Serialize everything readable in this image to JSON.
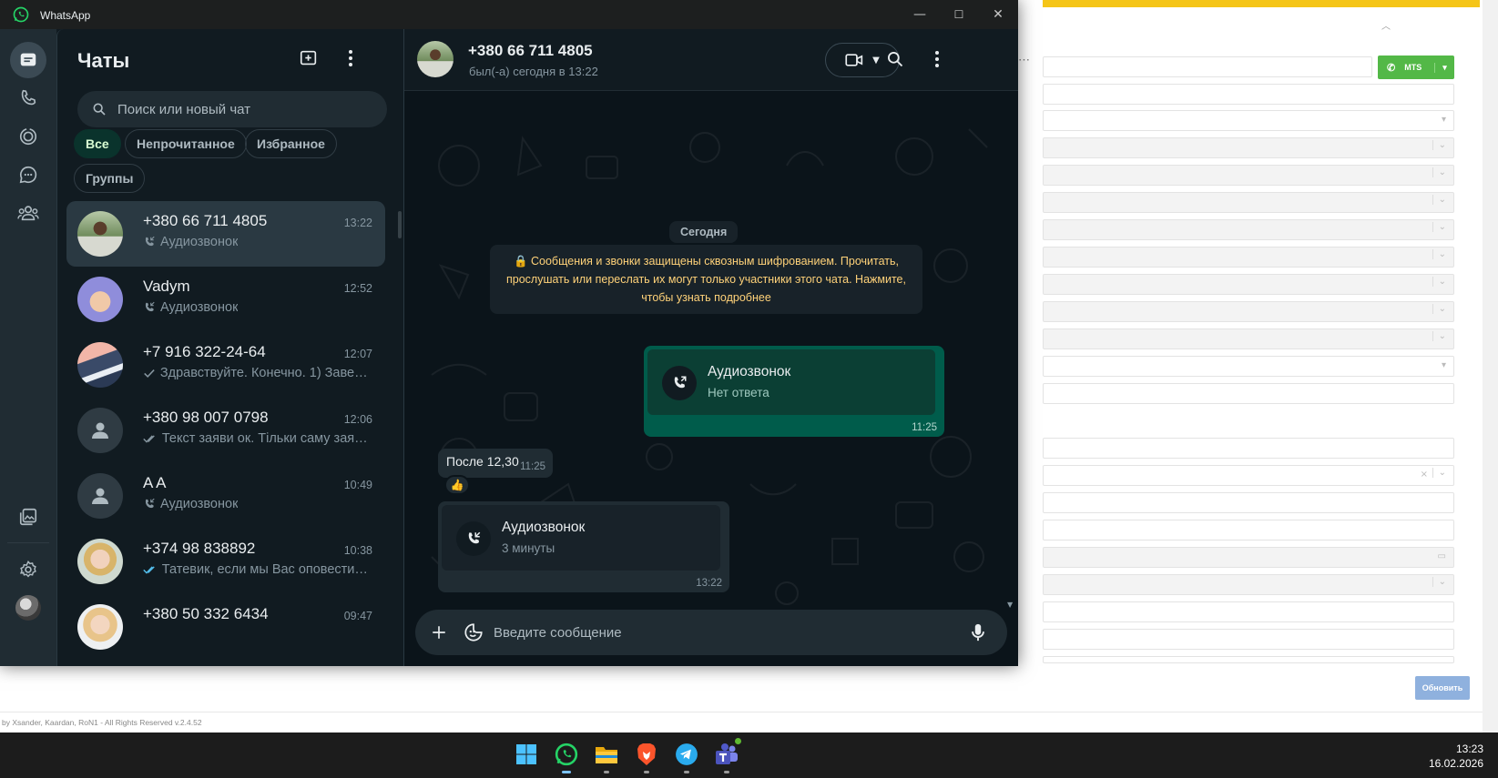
{
  "window": {
    "title": "WhatsApp"
  },
  "sidebar": {
    "title": "Чаты",
    "search_placeholder": "Поиск или новый чат",
    "filters": [
      "Все",
      "Непрочитанное",
      "Избранное",
      "Группы"
    ],
    "chats": [
      {
        "name": "+380 66 711 4805",
        "time": "13:22",
        "preview": "Аудиозвонок",
        "preview_icon": "call-icon",
        "selected": true
      },
      {
        "name": "Vadym",
        "time": "12:52",
        "preview": "Аудиозвонок",
        "preview_icon": "call-icon"
      },
      {
        "name": "+7 916 322-24-64",
        "time": "12:07",
        "preview": "Здравствуйте. Конечно. 1) Завер...",
        "preview_icon": "single-check-icon"
      },
      {
        "name": "+380 98 007 0798",
        "time": "12:06",
        "preview": "Текст заяви ок. Тільки саму заяв...",
        "preview_icon": "double-check-icon"
      },
      {
        "name": "A A",
        "time": "10:49",
        "preview": "Аудиозвонок",
        "preview_icon": "call-icon"
      },
      {
        "name": "+374 98 838892",
        "time": "10:38",
        "preview": "Татевик, если мы Вас оповестил...",
        "preview_icon": "double-check-read-icon"
      },
      {
        "name": "+380 50 332 6434",
        "time": "09:47",
        "preview": "",
        "preview_icon": ""
      }
    ]
  },
  "conversation": {
    "contact_name": "+380 66 711 4805",
    "contact_status": "был(-а) сегодня в 13:22",
    "date_label": "Сегодня",
    "encryption_notice": "🔒 Сообщения и звонки защищены сквозным шифрованием. Прочитать, прослушать или переслать их могут только участники этого чата. Нажмите, чтобы узнать подробнее",
    "messages": [
      {
        "type": "call",
        "direction": "out",
        "title": "Аудиозвонок",
        "subtitle": "Нет ответа",
        "time": "11:25"
      },
      {
        "type": "text",
        "direction": "in",
        "text": "После 12,30",
        "time": "11:25",
        "reaction": "👍"
      },
      {
        "type": "call",
        "direction": "in",
        "title": "Аудиозвонок",
        "subtitle": "3 минуты",
        "time": "13:22"
      }
    ],
    "composer_placeholder": "Введите сообщение"
  },
  "background_app": {
    "call_button_label": "MTS",
    "update_button_label": "Обновить",
    "footer": "by Xsander, Kaardan, RoN1 - All Rights Reserved v.2.4.52"
  },
  "taskbar": {
    "apps": [
      "windows-start-icon",
      "whatsapp-icon",
      "file-explorer-icon",
      "brave-browser-icon",
      "telegram-icon",
      "teams-icon"
    ],
    "time": "13:23",
    "date": "16.02.2026"
  },
  "colors": {
    "accent_green": "#00a884",
    "outgoing_bubble": "#005c4b",
    "incoming_bubble": "#202c33",
    "panel": "#111b21",
    "notice_text": "#ffd279"
  }
}
